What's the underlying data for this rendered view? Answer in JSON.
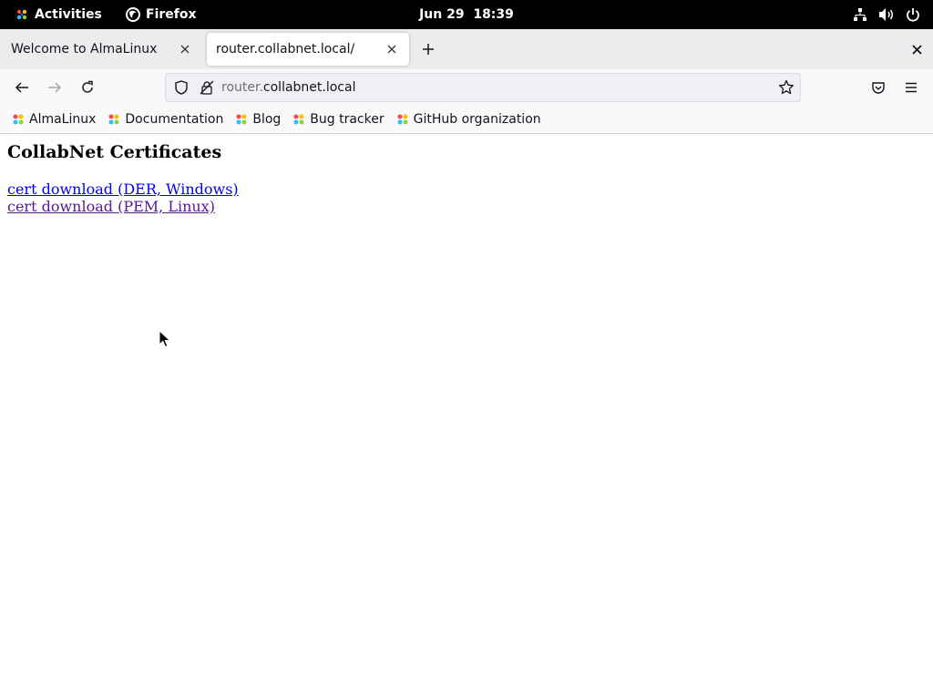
{
  "topbar": {
    "activities": "Activities",
    "app_name": "Firefox",
    "date": "Jun 29",
    "time": "18:39"
  },
  "tabs": [
    {
      "title": "Welcome to AlmaLinux",
      "active": false
    },
    {
      "title": "router.collabnet.local/",
      "active": true
    }
  ],
  "urlbar": {
    "subdomain": "router.",
    "domain": "collabnet.local"
  },
  "bookmarks": [
    {
      "label": "AlmaLinux"
    },
    {
      "label": "Documentation"
    },
    {
      "label": "Blog"
    },
    {
      "label": "Bug tracker"
    },
    {
      "label": "GitHub organization"
    }
  ],
  "page": {
    "heading": "CollabNet Certificates",
    "links": [
      {
        "label": "cert download (DER, Windows)"
      },
      {
        "label": "cert download (PEM, Linux)"
      }
    ]
  },
  "colors": {
    "link": "#0000ee",
    "link_visited": "#551a8b"
  }
}
